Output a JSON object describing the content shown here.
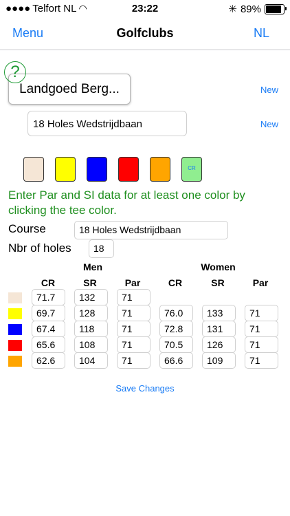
{
  "status": {
    "carrier": "Telfort NL",
    "time": "23:22",
    "battery": "89%"
  },
  "nav": {
    "left": "Menu",
    "title": "Golfclubs",
    "right": "NL"
  },
  "help_symbol": "?",
  "club_name": "Landgoed Berg...",
  "new_label": "New",
  "course_name": "18 Holes Wedstrijdbaan",
  "tee_colors": [
    "#f5e6d6",
    "#ffff00",
    "#0000ff",
    "#ff0000",
    "#ffa500",
    "#90ee90"
  ],
  "cr_swatch_label": "CR",
  "hint": "Enter Par and SI data for at least one color by clicking the tee color.",
  "course_label": "Course",
  "course_value": "18 Holes Wedstrijdbaan",
  "holes_label": "Nbr of holes",
  "holes_value": "18",
  "headers": {
    "men": "Men",
    "women": "Women",
    "cr": "CR",
    "sr": "SR",
    "par": "Par"
  },
  "rows": [
    {
      "color": "#f5e6d6",
      "men_cr": "71.7",
      "men_sr": "132",
      "men_par": "71",
      "women_cr": "",
      "women_sr": "",
      "women_par": ""
    },
    {
      "color": "#ffff00",
      "men_cr": "69.7",
      "men_sr": "128",
      "men_par": "71",
      "women_cr": "76.0",
      "women_sr": "133",
      "women_par": "71"
    },
    {
      "color": "#0000ff",
      "men_cr": "67.4",
      "men_sr": "118",
      "men_par": "71",
      "women_cr": "72.8",
      "women_sr": "131",
      "women_par": "71"
    },
    {
      "color": "#ff0000",
      "men_cr": "65.6",
      "men_sr": "108",
      "men_par": "71",
      "women_cr": "70.5",
      "women_sr": "126",
      "women_par": "71"
    },
    {
      "color": "#ffa500",
      "men_cr": "62.6",
      "men_sr": "104",
      "men_par": "71",
      "women_cr": "66.6",
      "women_sr": "109",
      "women_par": "71"
    }
  ],
  "save_label": "Save Changes"
}
